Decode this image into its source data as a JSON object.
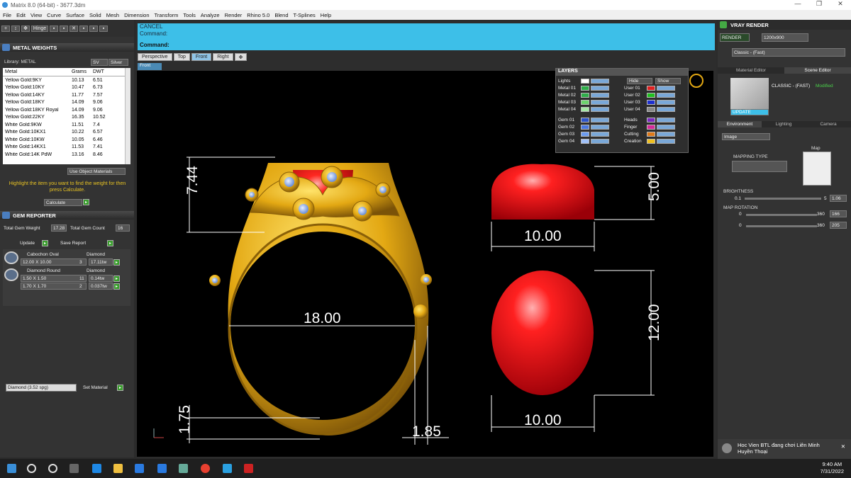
{
  "window": {
    "title": "Matrix 8.0 (64-bit) - 3677.3dm"
  },
  "menu": [
    "File",
    "Edit",
    "View",
    "Curve",
    "Surface",
    "Solid",
    "Mesh",
    "Dimension",
    "Transform",
    "Tools",
    "Analyze",
    "Render",
    "Rhino 5.0",
    "Blend",
    "T-Splines",
    "Help"
  ],
  "toolbar": {
    "hinge_label": "Hinge"
  },
  "metal_weights": {
    "title": "METAL WEIGHTS",
    "library_label": "Library: METAL",
    "sv_label": "SV",
    "silver_label": "Silver",
    "columns": [
      "Metal",
      "Grams",
      "DWT"
    ],
    "rows": [
      [
        "Yellow Gold:9KY",
        "10.13",
        "6.51"
      ],
      [
        "Yellow Gold:10KY",
        "10.47",
        "6.73"
      ],
      [
        "Yellow Gold:14KY",
        "11.77",
        "7.57"
      ],
      [
        "Yellow Gold:18KY",
        "14.09",
        "9.06"
      ],
      [
        "Yellow Gold:18KY Royal",
        "14.09",
        "9.06"
      ],
      [
        "Yellow Gold:22KY",
        "16.35",
        "10.52"
      ],
      [
        "White Gold:9KW",
        "11.51",
        "7.4"
      ],
      [
        "White Gold:10KX1",
        "10.22",
        "6.57"
      ],
      [
        "White Gold:10KW",
        "10.05",
        "6.46"
      ],
      [
        "White Gold:14KX1",
        "11.53",
        "7.41"
      ],
      [
        "White Gold:14K PdW",
        "13.16",
        "8.46"
      ]
    ],
    "use_object_materials": "Use Object Materials",
    "hint": "Highlight the item you want to find the weight for then press Calculate.",
    "calculate_label": "Calculate"
  },
  "gem_reporter": {
    "title": "GEM REPORTER",
    "total_weight_label": "Total Gem Weight",
    "total_weight_value": "17.28",
    "total_count_label": "Total Gem Count",
    "total_count_value": "16",
    "update_label": "Update",
    "save_report_label": "Save Report",
    "groups": [
      {
        "cut": "Cabochon Oval",
        "material": "Diamond",
        "lines": [
          {
            "size": "12.00 X 10.00",
            "count": "3",
            "weight": "17.11tw"
          }
        ]
      },
      {
        "cut": "Diamond Round",
        "material": "Diamond",
        "lines": [
          {
            "size": "1.50 X 1.50",
            "count": "11",
            "weight": "0.14tw"
          },
          {
            "size": "1.70 X 1.70",
            "count": "2",
            "weight": "0.037tw"
          }
        ]
      }
    ],
    "material_select": "Diamond      (3.52 spg)",
    "set_material_label": "Set Material"
  },
  "command": {
    "cancel": "CANCEL",
    "prompt": "Command:",
    "prompt2": "Command:"
  },
  "viewport_tabs": [
    "Perspective",
    "Top",
    "Front",
    "Right"
  ],
  "active_tab": "Front",
  "view_label": "Front",
  "layers": {
    "title": "LAYERS",
    "hide_label": "Hide",
    "show_label": "Show",
    "left": [
      {
        "name": "Lights",
        "color": "#ffffff"
      },
      {
        "name": "Metal 01",
        "color": "#2fae4a"
      },
      {
        "name": "Metal 02",
        "color": "#2fae4a"
      },
      {
        "name": "Metal 03",
        "color": "#6dd46d"
      },
      {
        "name": "Metal 04",
        "color": "#a6e8a6"
      },
      {
        "name": "Gem 01",
        "color": "#2e55c8"
      },
      {
        "name": "Gem 02",
        "color": "#4a78e0"
      },
      {
        "name": "Gem 03",
        "color": "#6c9cf0"
      },
      {
        "name": "Gem 04",
        "color": "#9fc0f8"
      }
    ],
    "right": [
      {
        "name": "User 01",
        "color": "#e02020"
      },
      {
        "name": "User 02",
        "color": "#20c020"
      },
      {
        "name": "User 03",
        "color": "#1e30d0"
      },
      {
        "name": "User 04",
        "color": "#888888"
      },
      {
        "name": "Heads",
        "color": "#7a2ac0"
      },
      {
        "name": "Finger",
        "color": "#d62a9a"
      },
      {
        "name": "Cutting",
        "color": "#e07a1a"
      },
      {
        "name": "Creation",
        "color": "#f0c020"
      }
    ]
  },
  "dimensions": {
    "top_height": "7.44",
    "inner_diameter": "18.00",
    "shank_thickness": "1.75",
    "shank_width": "1.85",
    "stone_side_height": "5.00",
    "stone_side_width": "10.00",
    "stone_top_length": "12.00",
    "stone_top_width": "10.00"
  },
  "vray": {
    "title": "VRAY RENDER",
    "render_label": "RENDER",
    "resolution": "1200x900",
    "preset_label": "Classic - (Fast)",
    "tabs": [
      "Material Editor",
      "Scene Editor"
    ],
    "material_name": "CLASSIC - (FAST)",
    "modified": "Modified",
    "update_label": "UPDATE",
    "env_tabs": [
      "Environment",
      "Lighting",
      "Camera"
    ],
    "image_select": "Image",
    "mapping_type": "MAPPING TYPE",
    "map_label": "Map",
    "brightness_label": "BRIGHTNESS",
    "brightness_min": "0.1",
    "brightness_max": "5",
    "brightness_value": "1.06",
    "map_rotation_label": "MAP ROTATION",
    "rot1_min": "0",
    "rot1_max": "360",
    "rot1_value": "166",
    "rot2_min": "0",
    "rot2_max": "360",
    "rot2_value": "205"
  },
  "notification": {
    "text1": "Hoc Vien BTL",
    "text2": "đang chơi Liên Minh",
    "text3": "Huyền Thoại"
  },
  "clock": {
    "time": "9:40 AM",
    "date": "7/31/2022"
  },
  "colors": {
    "accent": "#3dbfe8",
    "gold": "#e3b312",
    "ruby": "#e8141e"
  }
}
